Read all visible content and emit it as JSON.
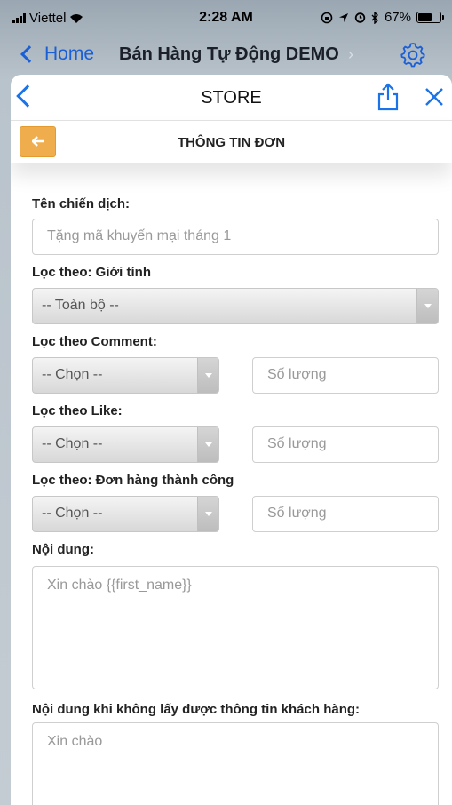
{
  "status_bar": {
    "carrier": "Viettel",
    "time": "2:28 AM",
    "battery": "67%",
    "battery_level": 0.67
  },
  "app_header": {
    "back_label": "Home",
    "title": "Bán Hàng Tự Động DEMO"
  },
  "sheet": {
    "title": "STORE"
  },
  "sub_header": {
    "title": "THÔNG TIN ĐƠN"
  },
  "form": {
    "campaign_label": "Tên chiến dịch:",
    "campaign_placeholder": "Tặng mã khuyến mại tháng 1",
    "gender_label": "Lọc theo: Giới tính",
    "gender_value": "-- Toàn bộ --",
    "comment_label": "Lọc theo Comment:",
    "comment_select": "-- Chọn --",
    "comment_qty_placeholder": "Số lượng",
    "like_label": "Lọc theo Like:",
    "like_select": "-- Chọn --",
    "like_qty_placeholder": "Số lượng",
    "order_label": "Lọc theo: Đơn hàng thành công",
    "order_select": "-- Chọn --",
    "order_qty_placeholder": "Số lượng",
    "content_label": "Nội dung:",
    "content_placeholder": "Xin chào {{first_name}}",
    "fallback_label": "Nội dung khi không lấy được thông tin khách hàng:",
    "fallback_placeholder": "Xin chào"
  },
  "colors": {
    "ios_blue": "#1a73e8",
    "orange": "#f0ad4e"
  }
}
